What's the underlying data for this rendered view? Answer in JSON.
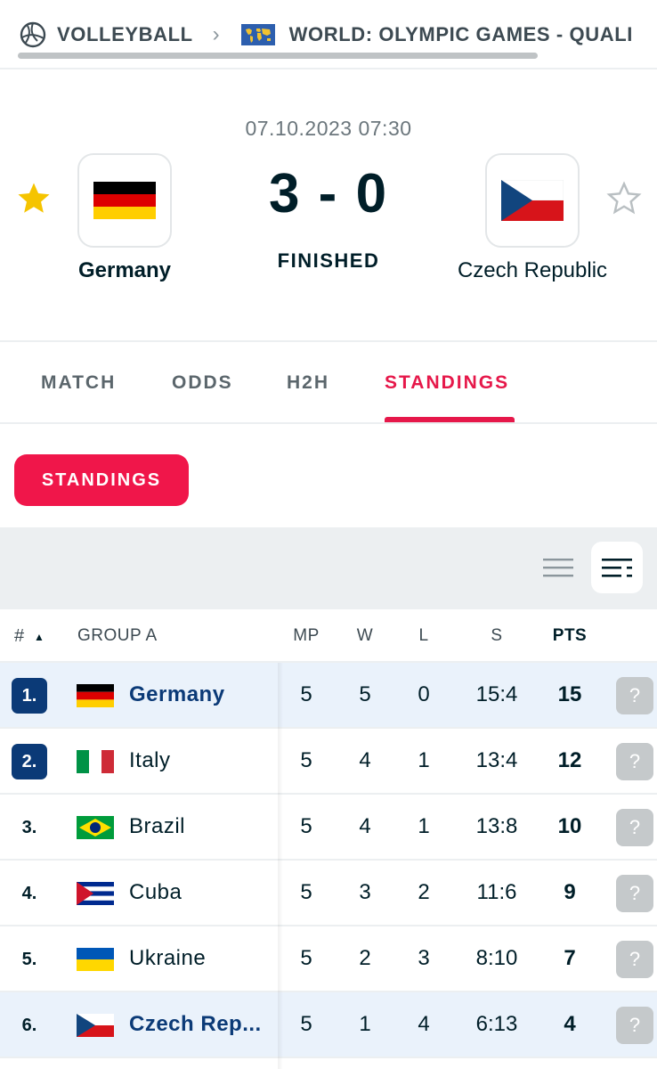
{
  "breadcrumb": {
    "sport": "VOLLEYBALL",
    "competition": "WORLD: OLYMPIC GAMES - QUALI",
    "sport_icon": "volleyball-icon",
    "separator_icon": "chevron-right-icon",
    "competition_icon": "world-map-flag-icon"
  },
  "match": {
    "datetime": "07.10.2023 07:30",
    "home": {
      "name": "Germany",
      "favorite": true
    },
    "away": {
      "name": "Czech Republic",
      "favorite": false
    },
    "score_home": "3",
    "score_sep": "-",
    "score_away": "0",
    "status": "FINISHED"
  },
  "tabs": [
    {
      "label": "MATCH",
      "active": false
    },
    {
      "label": "ODDS",
      "active": false
    },
    {
      "label": "H2H",
      "active": false
    },
    {
      "label": "STANDINGS",
      "active": true
    }
  ],
  "subtab": {
    "label": "STANDINGS"
  },
  "toolbar": {
    "compact_view_icon": "list-compact-icon",
    "detailed_view_icon": "list-detailed-icon",
    "selected": "detailed"
  },
  "table": {
    "headers": {
      "rank": "#",
      "sort": "▲",
      "group": "GROUP A",
      "mp": "MP",
      "w": "W",
      "l": "L",
      "s": "S",
      "pts": "PTS"
    },
    "rows": [
      {
        "rank": "1.",
        "team": "Germany",
        "mp": "5",
        "w": "5",
        "l": "0",
        "s": "15:4",
        "pts": "15",
        "help": "?"
      },
      {
        "rank": "2.",
        "team": "Italy",
        "mp": "5",
        "w": "4",
        "l": "1",
        "s": "13:4",
        "pts": "12",
        "help": "?"
      },
      {
        "rank": "3.",
        "team": "Brazil",
        "mp": "5",
        "w": "4",
        "l": "1",
        "s": "13:8",
        "pts": "10",
        "help": "?"
      },
      {
        "rank": "4.",
        "team": "Cuba",
        "mp": "5",
        "w": "3",
        "l": "2",
        "s": "11:6",
        "pts": "9",
        "help": "?"
      },
      {
        "rank": "5.",
        "team": "Ukraine",
        "mp": "5",
        "w": "2",
        "l": "3",
        "s": "8:10",
        "pts": "7",
        "help": "?"
      },
      {
        "rank": "6.",
        "team": "Czech Rep...",
        "mp": "5",
        "w": "1",
        "l": "4",
        "s": "6:13",
        "pts": "4",
        "help": "?"
      }
    ]
  },
  "colors": {
    "accent": "#e6184a",
    "qualification": "#0b3a77",
    "highlight_row": "#eaf2fb"
  }
}
